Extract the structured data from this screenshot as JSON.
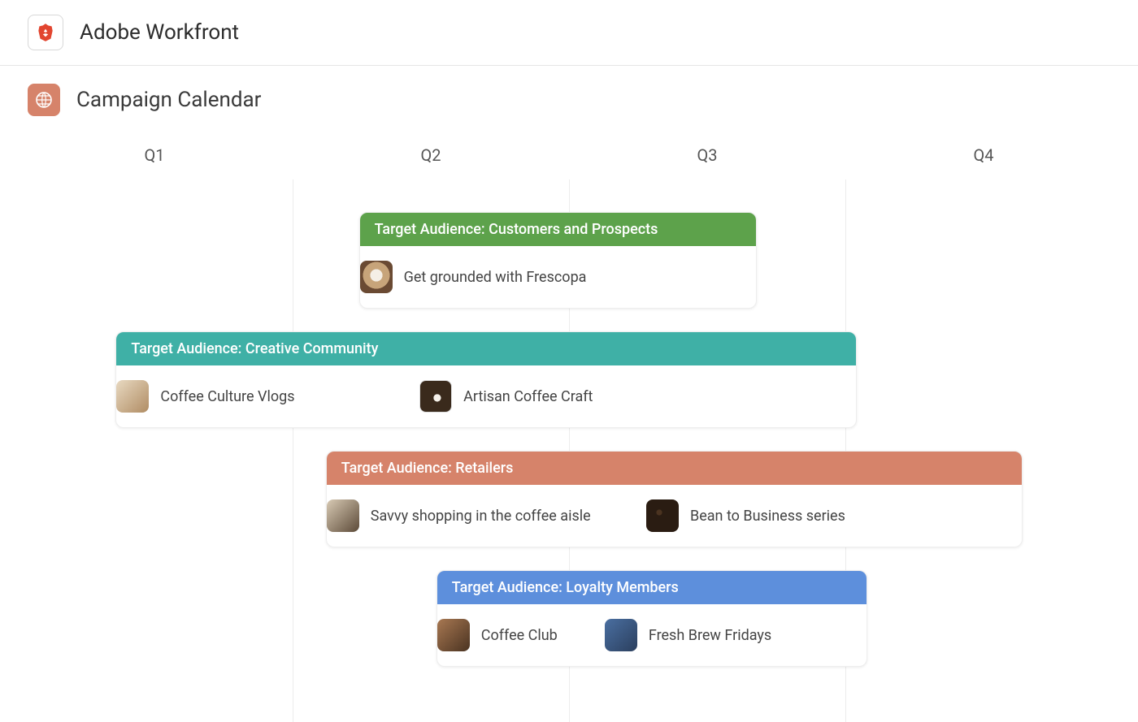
{
  "header": {
    "app_title": "Adobe Workfront",
    "page_title": "Campaign Calendar"
  },
  "quarters": [
    "Q1",
    "Q2",
    "Q3",
    "Q4"
  ],
  "colors": {
    "green": "#5da24b",
    "teal": "#3fb0a6",
    "coral": "#d6836a",
    "blue": "#5d8fdc"
  },
  "lanes": [
    {
      "id": "customers-prospects",
      "label": "Target Audience: Customers and Prospects",
      "color_key": "green",
      "start_pct": 31,
      "width_pct": 36,
      "items": [
        {
          "id": "frescopa",
          "label": "Get grounded with Frescopa",
          "thumb": "t-latte",
          "offset_pct": 0
        }
      ]
    },
    {
      "id": "creative-community",
      "label": "Target Audience: Creative Community",
      "color_key": "teal",
      "start_pct": 9,
      "width_pct": 67,
      "items": [
        {
          "id": "coffee-culture-vlogs",
          "label": "Coffee Culture Vlogs",
          "thumb": "t-vlog",
          "offset_pct": 0
        },
        {
          "id": "artisan-coffee-craft",
          "label": "Artisan Coffee Craft",
          "thumb": "t-espresso",
          "offset_pct": 41
        }
      ]
    },
    {
      "id": "retailers",
      "label": "Target Audience: Retailers",
      "color_key": "coral",
      "start_pct": 28,
      "width_pct": 63,
      "items": [
        {
          "id": "savvy-shopping",
          "label": "Savvy shopping in the coffee aisle",
          "thumb": "t-shop",
          "offset_pct": 0
        },
        {
          "id": "bean-to-business",
          "label": "Bean to Business series",
          "thumb": "t-beans",
          "offset_pct": 46
        }
      ]
    },
    {
      "id": "loyalty-members",
      "label": "Target Audience: Loyalty Members",
      "color_key": "blue",
      "start_pct": 38,
      "width_pct": 39,
      "items": [
        {
          "id": "coffee-club",
          "label": "Coffee Club",
          "thumb": "t-club",
          "offset_pct": 0
        },
        {
          "id": "fresh-brew-fridays",
          "label": "Fresh Brew Fridays",
          "thumb": "t-mug",
          "offset_pct": 39
        }
      ]
    }
  ]
}
